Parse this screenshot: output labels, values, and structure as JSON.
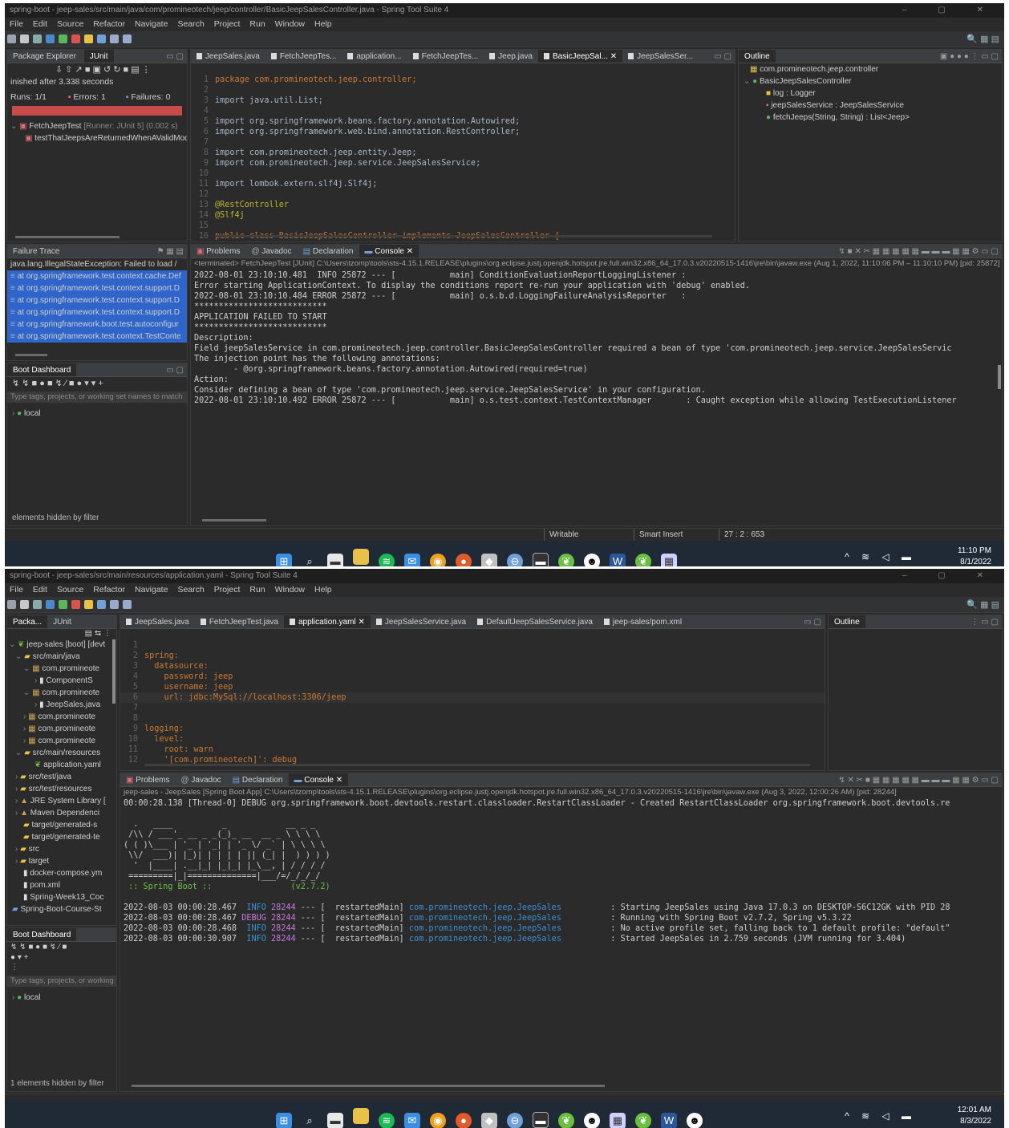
{
  "shot1": {
    "window_title": "spring-boot - jeep-sales/src/main/java/com/promineotech/jeep/controller/BasicJeepSalesController.java - Spring Tool Suite 4",
    "menu": [
      "File",
      "Edit",
      "Source",
      "Refactor",
      "Navigate",
      "Search",
      "Project",
      "Run",
      "Window",
      "Help"
    ],
    "left_tabs": [
      "Package Explorer",
      "JUnit"
    ],
    "junit": {
      "finished": "inished after 3.338 seconds",
      "runs_label": "Runs:",
      "runs_value": "1/1",
      "errors_label": "Errors:",
      "errors_value": "1",
      "failures_label": "Failures:",
      "failures_value": "0",
      "test_class": "FetchJeepTest",
      "test_runner": "[Runner: JUnit 5] (0.002 s)",
      "test_method": "testThatJeepsAreReturnedWhenAValidMode"
    },
    "failure_trace": {
      "title": "Failure Trace",
      "lines": [
        "java.lang.IllegalStateException: Failed to load /",
        "at org.springframework.test.context.cache.Def",
        "at org.springframework.test.context.support.D",
        "at org.springframework.test.context.support.D",
        "at org.springframework.test.context.support.D",
        "at org.springframework.boot.test.autoconfigur",
        "at org.springframework.test.context.TestConte"
      ]
    },
    "boot_dashboard": {
      "title": "Boot Dashboard",
      "filter_placeholder": "Type tags, projects, or working set names to match",
      "item": "local",
      "footer": "elements hidden by filter"
    },
    "editor_tabs": [
      "JeepSales.java",
      "FetchJeepTes...",
      "application...",
      "FetchJeepTes...",
      "Jeep.java",
      "BasicJeepSal...",
      "JeepSalesSer..."
    ],
    "code": [
      {
        "n": "1",
        "t": "package com.promineotech.jeep.controller;"
      },
      {
        "n": "2",
        "t": ""
      },
      {
        "n": "3",
        "t": "import java.util.List;"
      },
      {
        "n": "4",
        "t": ""
      },
      {
        "n": "5",
        "t": "import org.springframework.beans.factory.annotation.Autowired;"
      },
      {
        "n": "6",
        "t": "import org.springframework.web.bind.annotation.RestController;"
      },
      {
        "n": "7",
        "t": ""
      },
      {
        "n": "8",
        "t": "import com.promineotech.jeep.entity.Jeep;"
      },
      {
        "n": "9",
        "t": "import com.promineotech.jeep.service.JeepSalesService;"
      },
      {
        "n": "10",
        "t": ""
      },
      {
        "n": "11",
        "t": "import lombok.extern.slf4j.Slf4j;"
      },
      {
        "n": "12",
        "t": ""
      },
      {
        "n": "13",
        "t": "@RestController"
      },
      {
        "n": "14",
        "t": "@Slf4j"
      },
      {
        "n": "15",
        "t": ""
      },
      {
        "n": "16",
        "t": "public class BasicJeepSalesController implements JeepSalesController {"
      }
    ],
    "outline": {
      "title": "Outline",
      "items": [
        "com.promineotech.jeep.controller",
        "BasicJeepSalesController",
        "log : Logger",
        "jeepSalesService : JeepSalesService",
        "fetchJeeps(String, String) : List<Jeep>"
      ]
    },
    "console_tabs": [
      "Problems",
      "Javadoc",
      "Declaration",
      "Console"
    ],
    "console_path": "<terminated> FetchJeepTest [JUnit] C:\\Users\\tzomp\\tools\\sts-4.15.1.RELEASE\\plugins\\org.eclipse.justj.openjdk.hotspot.jre.full.win32.x86_64_17.0.3.v20220515-1416\\jre\\bin\\javaw.exe  (Aug 1, 2022, 11:10:06 PM – 11:10:10 PM) [pid: 25872]",
    "console": [
      "2022-08-01 23:10:10.481  INFO 25872 --- [           main] ConditionEvaluationReportLoggingListener :",
      "",
      "Error starting ApplicationContext. To display the conditions report re-run your application with 'debug' enabled.",
      "2022-08-01 23:10:10.484 ERROR 25872 --- [           main] o.s.b.d.LoggingFailureAnalysisReporter   :",
      "",
      "***************************",
      "APPLICATION FAILED TO START",
      "***************************",
      "",
      "Description:",
      "",
      "Field jeepSalesService in com.promineotech.jeep.controller.BasicJeepSalesController required a bean of type 'com.promineotech.jeep.service.JeepSalesServic",
      "",
      "The injection point has the following annotations:",
      "        - @org.springframework.beans.factory.annotation.Autowired(required=true)",
      "",
      "",
      "Action:",
      "",
      "Consider defining a bean of type 'com.promineotech.jeep.service.JeepSalesService' in your configuration.",
      "",
      "2022-08-01 23:10:10.492 ERROR 25872 --- [           main] o.s.test.context.TestContextManager       : Caught exception while allowing TestExecutionListener"
    ],
    "status": {
      "writable": "Writable",
      "insert": "Smart Insert",
      "position": "27 : 2 : 653"
    },
    "clock": {
      "time": "11:10 PM",
      "date": "8/1/2022"
    }
  },
  "shot2": {
    "window_title": "spring-boot - jeep-sales/src/main/resources/application.yaml - Spring Tool Suite 4",
    "menu": [
      "File",
      "Edit",
      "Source",
      "Refactor",
      "Navigate",
      "Search",
      "Project",
      "Run",
      "Window",
      "Help"
    ],
    "left_tabs": [
      "Packa...",
      "JUnit"
    ],
    "tree": [
      "jeep-sales [boot] [devt",
      "src/main/java",
      "com.promineote",
      "ComponentS",
      "com.promineote",
      "JeepSales.java",
      "com.promineote",
      "com.promineote",
      "com.promineote",
      "src/main/resources",
      "application.yaml",
      "src/test/java",
      "src/test/resources",
      "JRE System Library [",
      "Maven Dependenci",
      "target/generated-s",
      "target/generated-te",
      "src",
      "target",
      "docker-compose.ym",
      "pom.xml",
      "Spring-Week13_Coc",
      "Spring-Boot-Course-St"
    ],
    "boot_dashboard": {
      "title": "Boot Dashboard",
      "filter_placeholder": "Type tags, projects, or working",
      "item": "local",
      "footer": "1 elements hidden by filter"
    },
    "editor_tabs": [
      "JeepSales.java",
      "FetchJeepTest.java",
      "application.yaml",
      "JeepSalesService.java",
      "DefaultJeepSalesService.java",
      "jeep-sales/pom.xml"
    ],
    "yaml": [
      {
        "n": "1",
        "t": ""
      },
      {
        "n": "2",
        "t": "spring:"
      },
      {
        "n": "3",
        "t": "  datasource:"
      },
      {
        "n": "4",
        "t": "    password: jeep"
      },
      {
        "n": "5",
        "t": "    username: jeep"
      },
      {
        "n": "6",
        "t": "    url: jdbc:MySql://localhost:3306/jeep"
      },
      {
        "n": "7",
        "t": ""
      },
      {
        "n": "8",
        "t": ""
      },
      {
        "n": "9",
        "t": "logging:"
      },
      {
        "n": "10",
        "t": "  level:"
      },
      {
        "n": "11",
        "t": "    root: warn"
      },
      {
        "n": "12",
        "t": "    '[com.promineotech]': debug"
      }
    ],
    "outline_title": "Outline",
    "console_tabs": [
      "Problems",
      "Javadoc",
      "Declaration",
      "Console"
    ],
    "console_path": "jeep-sales - JeepSales [Spring Boot App] C:\\Users\\tzomp\\tools\\sts-4.15.1.RELEASE\\plugins\\org.eclipse.justj.openjdk.hotspot.jre.full.win32.x86_64_17.0.3.v20220515-1416\\jre\\bin\\javaw.exe  (Aug 3, 2022, 12:00:26 AM) [pid: 28244]",
    "console_first": "00:00:28.138 [Thread-0] DEBUG org.springframework.boot.devtools.restart.classloader.RestartClassLoader - Created RestartClassLoader org.springframework.boot.devtools.re",
    "banner": [
      "  .   ____          _            __ _ _",
      " /\\\\ / ___'_ __ _ _(_)_ __  __ _ \\ \\ \\ \\",
      "( ( )\\___ | '_ | '_| | '_ \\/ _` | \\ \\ \\ \\",
      " \\\\/  ___)| |_)| | | | | || (_| |  ) ) ) )",
      "  '  |____| .__|_| |_|_| |_\\__, | / / / /",
      " =========|_|==============|___/=/_/_/_/",
      " :: Spring Boot ::                (v2.7.2)"
    ],
    "logs": [
      {
        "ts": "2022-08-03 00:00:28.467",
        "level": "INFO",
        "pid": "28244",
        "thread": "restartedMain",
        "logger": "com.promineotech.jeep.JeepSales",
        "msg": ": Starting JeepSales using Java 17.0.3 on DESKTOP-S6C12GK with PID 28"
      },
      {
        "ts": "2022-08-03 00:00:28.467",
        "level": "DEBUG",
        "pid": "28244",
        "thread": "restartedMain",
        "logger": "com.promineotech.jeep.JeepSales",
        "msg": ": Running with Spring Boot v2.7.2, Spring v5.3.22"
      },
      {
        "ts": "2022-08-03 00:00:28.468",
        "level": "INFO",
        "pid": "28244",
        "thread": "restartedMain",
        "logger": "com.promineotech.jeep.JeepSales",
        "msg": ": No active profile set, falling back to 1 default profile: \"default\""
      },
      {
        "ts": "2022-08-03 00:00:30.907",
        "level": "INFO",
        "pid": "28244",
        "thread": "restartedMain",
        "logger": "com.promineotech.jeep.JeepSales",
        "msg": ": Started JeepSales in 2.759 seconds (JVM running for 3.404)"
      }
    ],
    "clock": {
      "time": "12:01 AM",
      "date": "8/3/2022"
    }
  },
  "colors": {
    "ide_bg": "#2b2b2b",
    "tab_bg": "#3c3f41",
    "taskbar_bg": "#1f2a36",
    "junit_error": "#c74b4b",
    "log_info": "#3a8fd6",
    "log_debug": "#c678dd"
  },
  "taskbar_icons": [
    "windows-start-icon",
    "search-icon",
    "task-view-icon",
    "file-explorer-icon",
    "spotify-icon",
    "mail-icon",
    "chrome-icon",
    "firefox-icon",
    "git-icon",
    "app-icon",
    "terminal-icon",
    "spring-tool-suite-icon",
    "github-icon",
    "word-icon",
    "spring-tool-suite-icon",
    "app-icon"
  ]
}
